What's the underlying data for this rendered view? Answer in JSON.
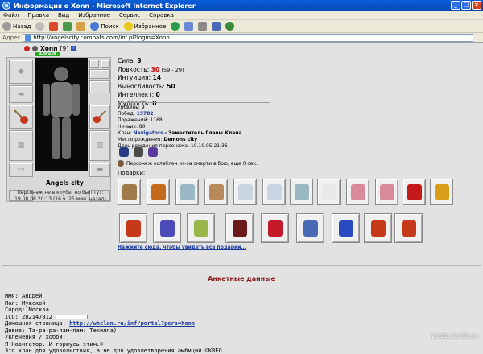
{
  "window": {
    "title": "Информация о Xonn - Microsoft Internet Explorer"
  },
  "menu": [
    "Файл",
    "Правка",
    "Вид",
    "Избранное",
    "Сервис",
    "Справка"
  ],
  "toolbar": {
    "back": "Назад",
    "search": "Поиск",
    "favorites": "Избранное"
  },
  "address": {
    "label": "Адрес",
    "url": "http://angelscity.combats.com/inf.pl?login=Xonn"
  },
  "character": {
    "name": "Xonn",
    "level": "[9]",
    "hp": "438/438",
    "city": "Angels city",
    "status_line1": "Персонаж не в клубе, но был тут:",
    "status_line2": "19.08.08 20:13 (16 ч. 25 мин. назад)"
  },
  "stats": {
    "strength": {
      "label": "Сила:",
      "value": "3"
    },
    "agility": {
      "label": "Ловкость:",
      "value": "30",
      "extra": "(59 - 29)"
    },
    "intuition": {
      "label": "Интуиция:",
      "value": "14"
    },
    "endurance": {
      "label": "Выносливость:",
      "value": "50"
    },
    "intellect": {
      "label": "Интеллект:",
      "value": "0"
    },
    "wisdom": {
      "label": "Мудрость:",
      "value": "0"
    }
  },
  "details": {
    "level": {
      "label": "Уровень:",
      "value": "9"
    },
    "wins": {
      "label": "Побед:",
      "value": "15782"
    },
    "losses": {
      "label": "Поражений:",
      "value": "1168"
    },
    "draws": {
      "label": "Ничьих:",
      "value": "80"
    },
    "clan": {
      "label": "Клан:",
      "value": "Navigators",
      "role": "- Заместитель Главы Клана"
    },
    "birthplace": {
      "label": "Место рождения:",
      "value": "Demons city"
    },
    "birthday": {
      "label": "День рождения персонажа:",
      "value": "10.10.05 21:36"
    }
  },
  "death_note": "Персонаж ослаблен из-за смерти в бою, еще 0 сек.",
  "gifts": {
    "title": "Подарки:",
    "link": "Нажмите сюда, чтобы увидеть все подарки...",
    "colors": [
      "#a07a4a",
      "#c46a1a",
      "#9ab8c4",
      "#b88a5a",
      "#c8d4e0",
      "#c8d4e0",
      "#9ab8c4",
      "#e8e8e8",
      "#d88a9a",
      "#d88a9a",
      "#c41a1a",
      "#d8a01a",
      "#c43a1a",
      "#4a4ab8",
      "#9ab84a",
      "#6a1a1a",
      "#c41a2a",
      "#4a6ab8",
      "#2a4ac4",
      "#c43a1a",
      "#c43a1a",
      "#4a6ab8"
    ]
  },
  "anketa": {
    "title": "Анкетные данные",
    "name": "Имя: Андрей",
    "gender": "Пол: Мужской",
    "city": "Город: Москва",
    "icq": "ICQ: 282147812",
    "homepage_label": "Домашняя страница:",
    "homepage_url": "http://whclan.ru/inf/portal?pers=Xonn",
    "motto": "Девиз: Та-ра-ра-пам-пам: Текилла)",
    "hobby_label": "Увлечения / хобби:",
    "hobby1": "Я Навигатор. И горжусь этим.©",
    "hobby2": "Это клан для удовольствия, а не для удовлетворения амбиций.©KREO"
  },
  "watermark": "photo.scrolls.ru"
}
